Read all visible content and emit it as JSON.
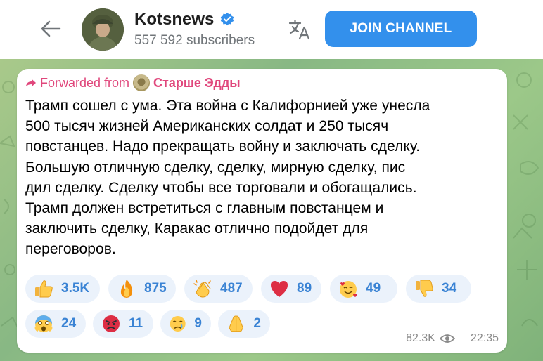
{
  "header": {
    "channel_name": "Kotsnews",
    "subscribers": "557 592 subscribers",
    "join_label": "JOIN CHANNEL"
  },
  "message": {
    "forwarded_prefix": "Forwarded from",
    "forwarded_source": "Старше Эдды",
    "lines": [
      "Трамп сошел с ума. Эта война с Калифорнией уже унесла",
      "500 тысяч жизней Американских солдат и 250 тысяч",
      "повстанцев. Надо прекращать войну и заключать сделку.",
      "Большую отличную сделку, сделку, мирную сделку, пис",
      "дил сделку. Сделку чтобы все торговали и обогащались.",
      "Трамп должен встретиться с главным повстанцем и",
      "заключить сделку, Каракас отлично подойдет для",
      "переговоров."
    ],
    "views": "82.3K",
    "time": "22:35"
  },
  "reactions": [
    {
      "emoji": "thumbs-up",
      "count": "3.5K"
    },
    {
      "emoji": "fire",
      "count": "875"
    },
    {
      "emoji": "clapping-hands",
      "count": "487"
    },
    {
      "emoji": "red-heart",
      "count": "89"
    },
    {
      "emoji": "smiling-face-with-hearts",
      "count": "49"
    },
    {
      "emoji": "thumbs-down",
      "count": "34"
    },
    {
      "emoji": "screaming-face",
      "count": "24"
    },
    {
      "emoji": "angry-face",
      "count": "11"
    },
    {
      "emoji": "crying-face",
      "count": "9"
    },
    {
      "emoji": "folded-hands",
      "count": "2"
    }
  ],
  "colors": {
    "accent": "#3390ec",
    "forwarded": "#e0477c",
    "reaction_bg": "#ebf2fb",
    "reaction_text": "#3a83d4"
  }
}
